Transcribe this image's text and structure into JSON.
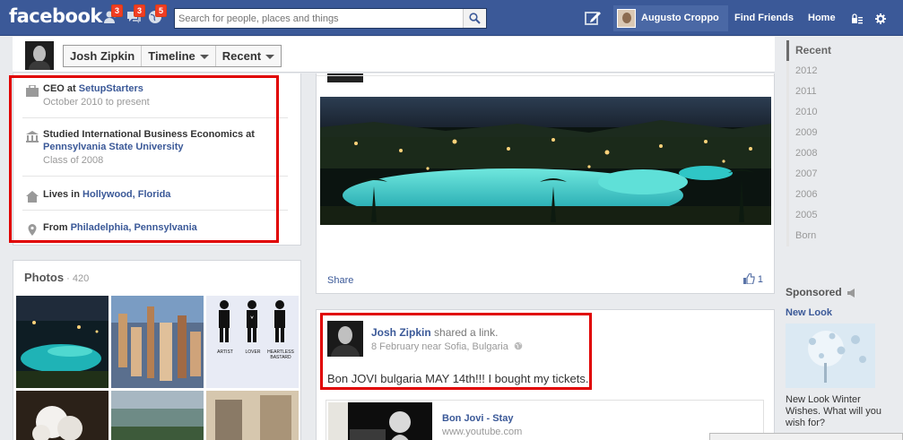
{
  "topbar": {
    "logo": "facebook",
    "friend_requests_count": "3",
    "messages_count": "3",
    "notifications_count": "5",
    "search_placeholder": "Search for people, places and things",
    "user_name": "Augusto Croppo",
    "find_friends": "Find Friends",
    "home": "Home",
    "bg_color": "#3b5998"
  },
  "profile_header": {
    "name": "Josh Zipkin",
    "timeline": "Timeline",
    "recent": "Recent"
  },
  "about": {
    "work": {
      "prefix": "CEO at ",
      "link": "SetupStarters",
      "sub": "October 2010 to present"
    },
    "education": {
      "prefix": "Studied International Business Economics at ",
      "link": "Pennsylvania State University",
      "sub": "Class of 2008"
    },
    "lives": {
      "prefix": "Lives in ",
      "link": "Hollywood, Florida"
    },
    "from": {
      "prefix": "From ",
      "link": "Philadelphia, Pennsylvania"
    }
  },
  "photos": {
    "title": "Photos",
    "count": "420",
    "figure_labels": [
      "ARTIST",
      "LOVER",
      "HEARTLESS BASTARD"
    ]
  },
  "post1": {
    "share": "Share",
    "likes": "1"
  },
  "post2": {
    "author": "Josh Zipkin",
    "action": "shared a link.",
    "meta": "8 February near Sofia, Bulgaria",
    "message": "Bon JOVI bulgaria MAY 14th!!! I bought my tickets.",
    "link_title": "Bon Jovi - Stay",
    "link_url": "www.youtube.com"
  },
  "rail": {
    "years": [
      "Recent",
      "2012",
      "2011",
      "2010",
      "2009",
      "2008",
      "2007",
      "2006",
      "2005",
      "Born"
    ],
    "sponsored": "Sponsored",
    "ad_title": "New Look",
    "ad_text": "New Look Winter Wishes. What will you wish for?"
  },
  "highlight_color": "#e00000"
}
